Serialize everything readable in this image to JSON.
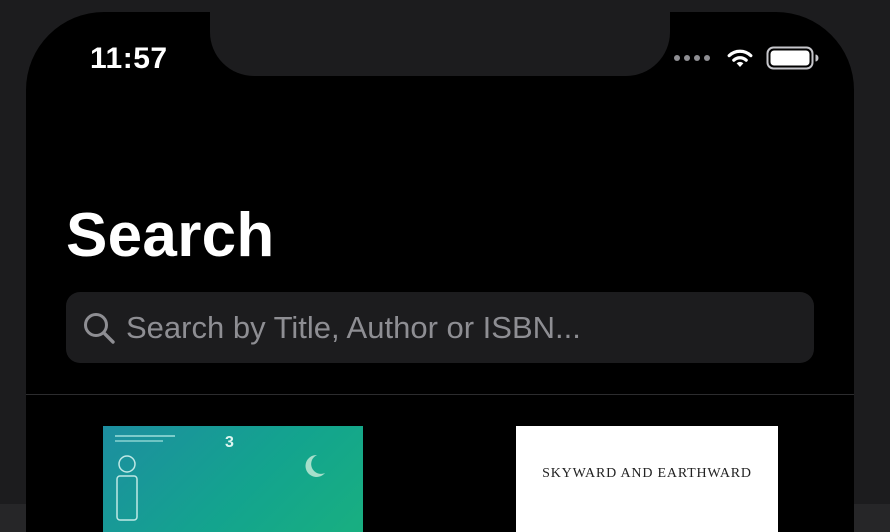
{
  "status_bar": {
    "time": "11:57",
    "icons": [
      "signal-dots-icon",
      "wifi-icon",
      "battery-icon"
    ]
  },
  "header": {
    "title": "Search"
  },
  "search": {
    "placeholder": "Search by Title, Author or ISBN...",
    "value": ""
  },
  "results": [
    {
      "cover_number": "3",
      "cover_color": "#13a48e"
    },
    {
      "cover_title": "SKYWARD AND EARTHWARD",
      "cover_color": "#ffffff"
    }
  ],
  "colors": {
    "background": "#000000",
    "search_field": "#1c1c1e",
    "placeholder": "#8e8e93",
    "text": "#ffffff"
  }
}
